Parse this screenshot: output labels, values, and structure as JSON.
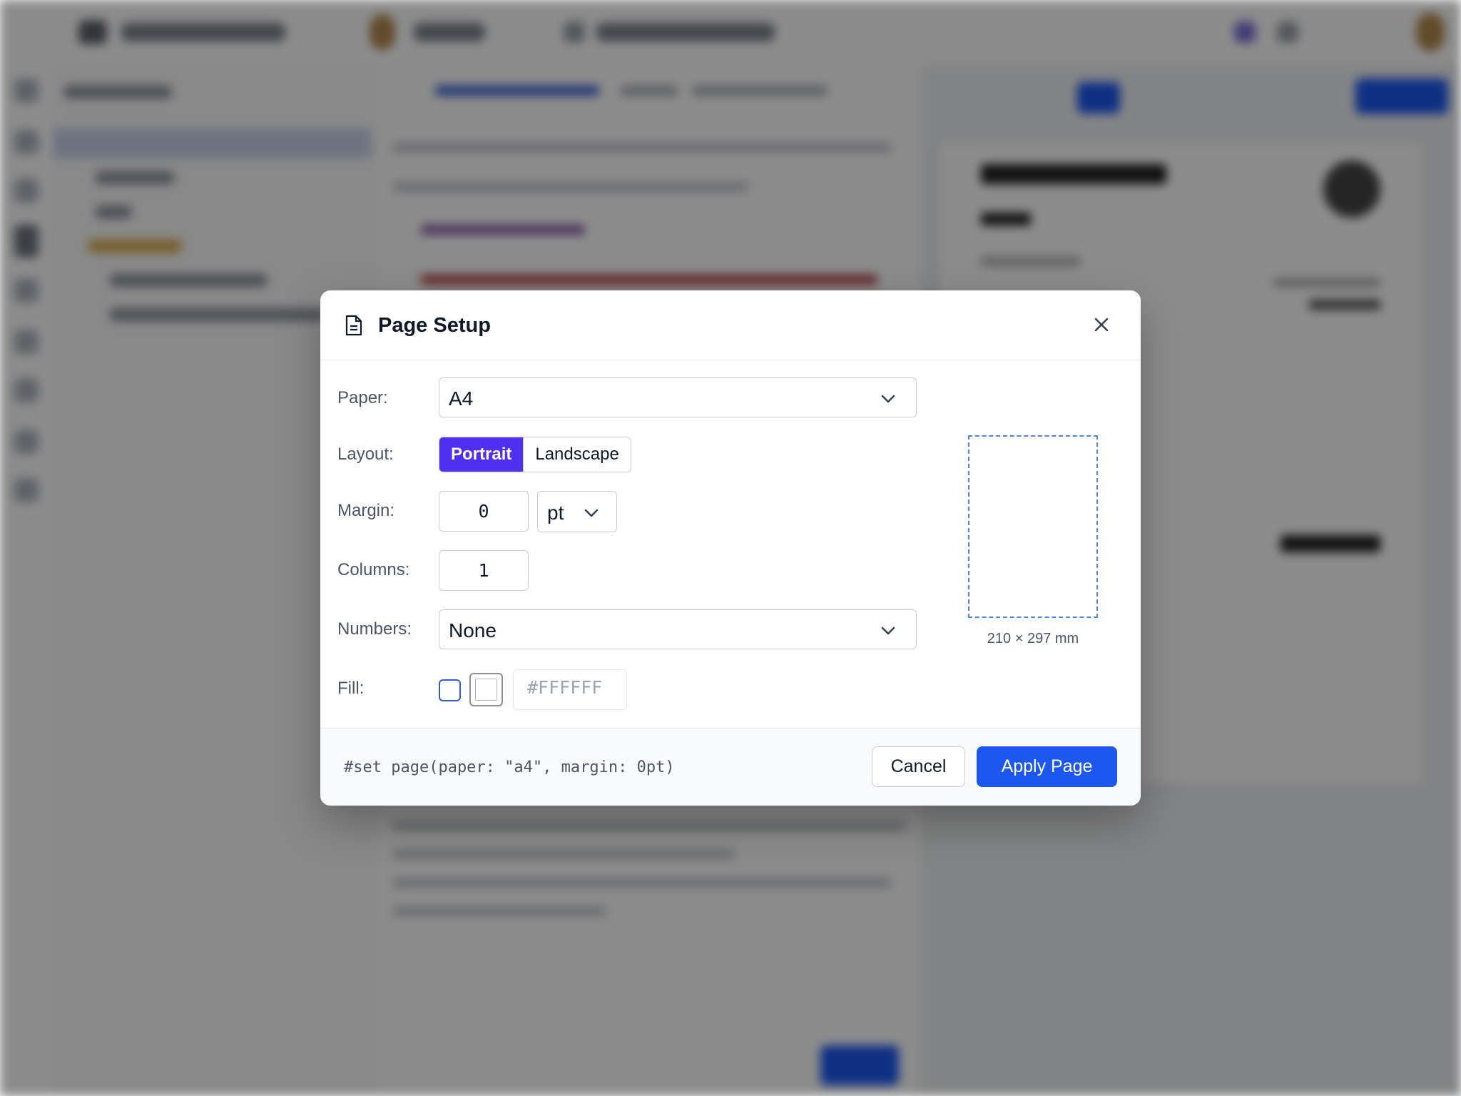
{
  "dialog": {
    "title": "Page Setup",
    "title_icon": "document-icon",
    "close_icon": "close-icon"
  },
  "form": {
    "paper": {
      "label": "Paper:",
      "value": "A4"
    },
    "layout": {
      "label": "Layout:",
      "options": [
        "Portrait",
        "Landscape"
      ],
      "selected": "Portrait"
    },
    "margin": {
      "label": "Margin:",
      "value": "0",
      "unit": "pt"
    },
    "columns": {
      "label": "Columns:",
      "value": "1"
    },
    "numbers": {
      "label": "Numbers:",
      "value": "None"
    },
    "fill": {
      "label": "Fill:",
      "enabled": false,
      "color_placeholder": "#FFFFFF"
    }
  },
  "preview": {
    "dimensions": "210 × 297 mm"
  },
  "footer": {
    "code": "#set page(paper: \"a4\", margin: 0pt)",
    "cancel_label": "Cancel",
    "apply_label": "Apply Page"
  },
  "colors": {
    "accent_purple": "#4f2ff0",
    "primary_blue": "#1c57f0",
    "preview_dash": "#4a86e8"
  }
}
